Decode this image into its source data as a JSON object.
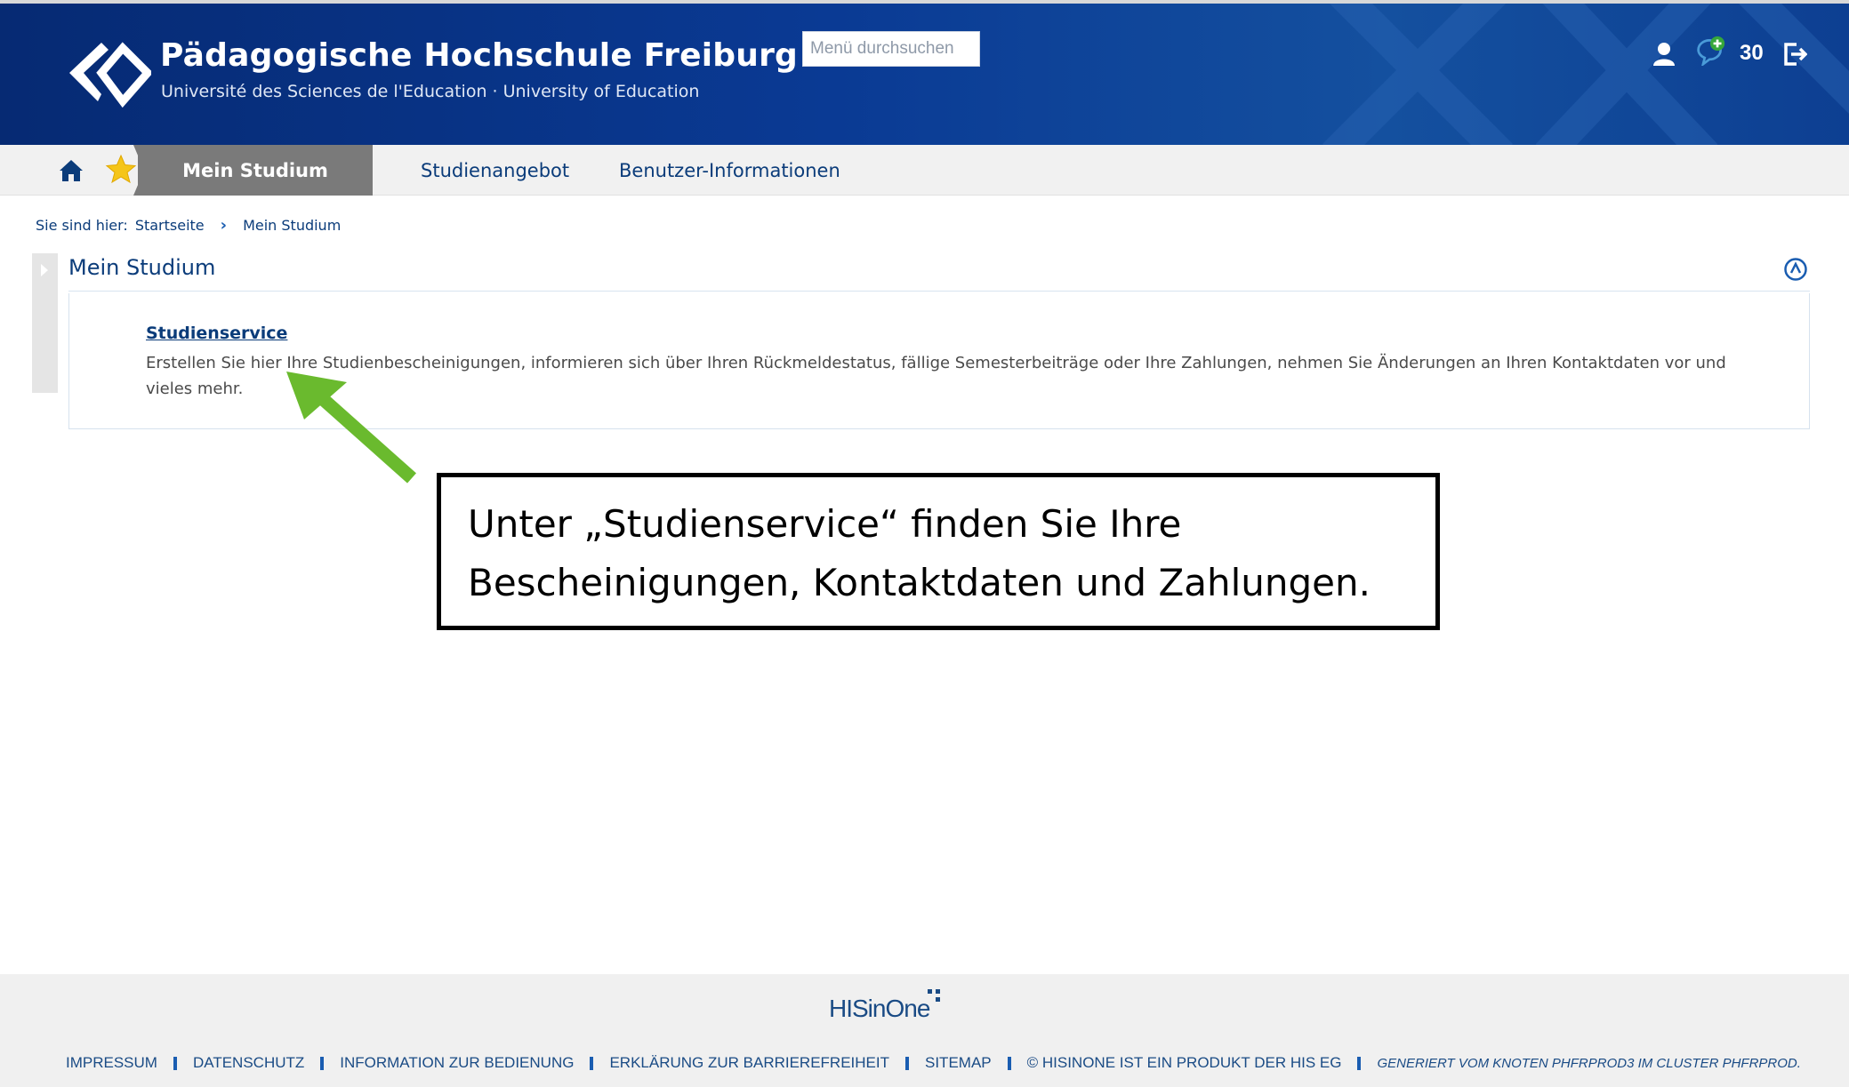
{
  "header": {
    "title": "Pädagogische Hochschule Freiburg",
    "subtitle": "Université des Sciences de l'Education · University of Education",
    "search_placeholder": "Menü durchsuchen",
    "notification_count": "30",
    "icons": [
      "user-icon",
      "chat-add-icon",
      "logout-icon"
    ]
  },
  "nav": {
    "icons": [
      "home-icon",
      "star-icon"
    ],
    "tabs": [
      {
        "label": "Mein Studium",
        "active": true
      },
      {
        "label": "Studienangebot",
        "active": false
      },
      {
        "label": "Benutzer-Informationen",
        "active": false
      }
    ]
  },
  "breadcrumb": {
    "prefix": "Sie sind hier:",
    "items": [
      "Startseite",
      "Mein Studium"
    ]
  },
  "main": {
    "title": "Mein Studium",
    "card": {
      "link": "Studienservice",
      "description": "Erstellen Sie hier Ihre Studienbescheinigungen, informieren sich über Ihren Rückmeldestatus, fällige Semesterbeiträge oder Ihre Zahlungen, nehmen Sie Änderungen an Ihren Kontaktdaten vor und vieles mehr."
    }
  },
  "annotation": {
    "line1": "Unter „Studienservice“ finden Sie Ihre",
    "line2": "Bescheinigungen, Kontaktdaten und Zahlungen.",
    "arrow_color": "#6aba2e"
  },
  "footer": {
    "brand": "HISinOne",
    "links": [
      "IMPRESSUM",
      "DATENSCHUTZ",
      "INFORMATION ZUR BEDIENUNG",
      "ERKLÄRUNG ZUR BARRIEREFREIHEIT",
      "SITEMAP",
      "© HISINONE IST EIN PRODUKT DER HIS EG"
    ],
    "generated": "GENERIERT VOM KNOTEN PHFRPROD3 IM CLUSTER PHFRPROD."
  },
  "colors": {
    "header_bg": "#0a3a94",
    "nav_active_bg": "#7a7a7a",
    "link_blue": "#0b3c7a",
    "footer_bg": "#f0f0f0"
  }
}
